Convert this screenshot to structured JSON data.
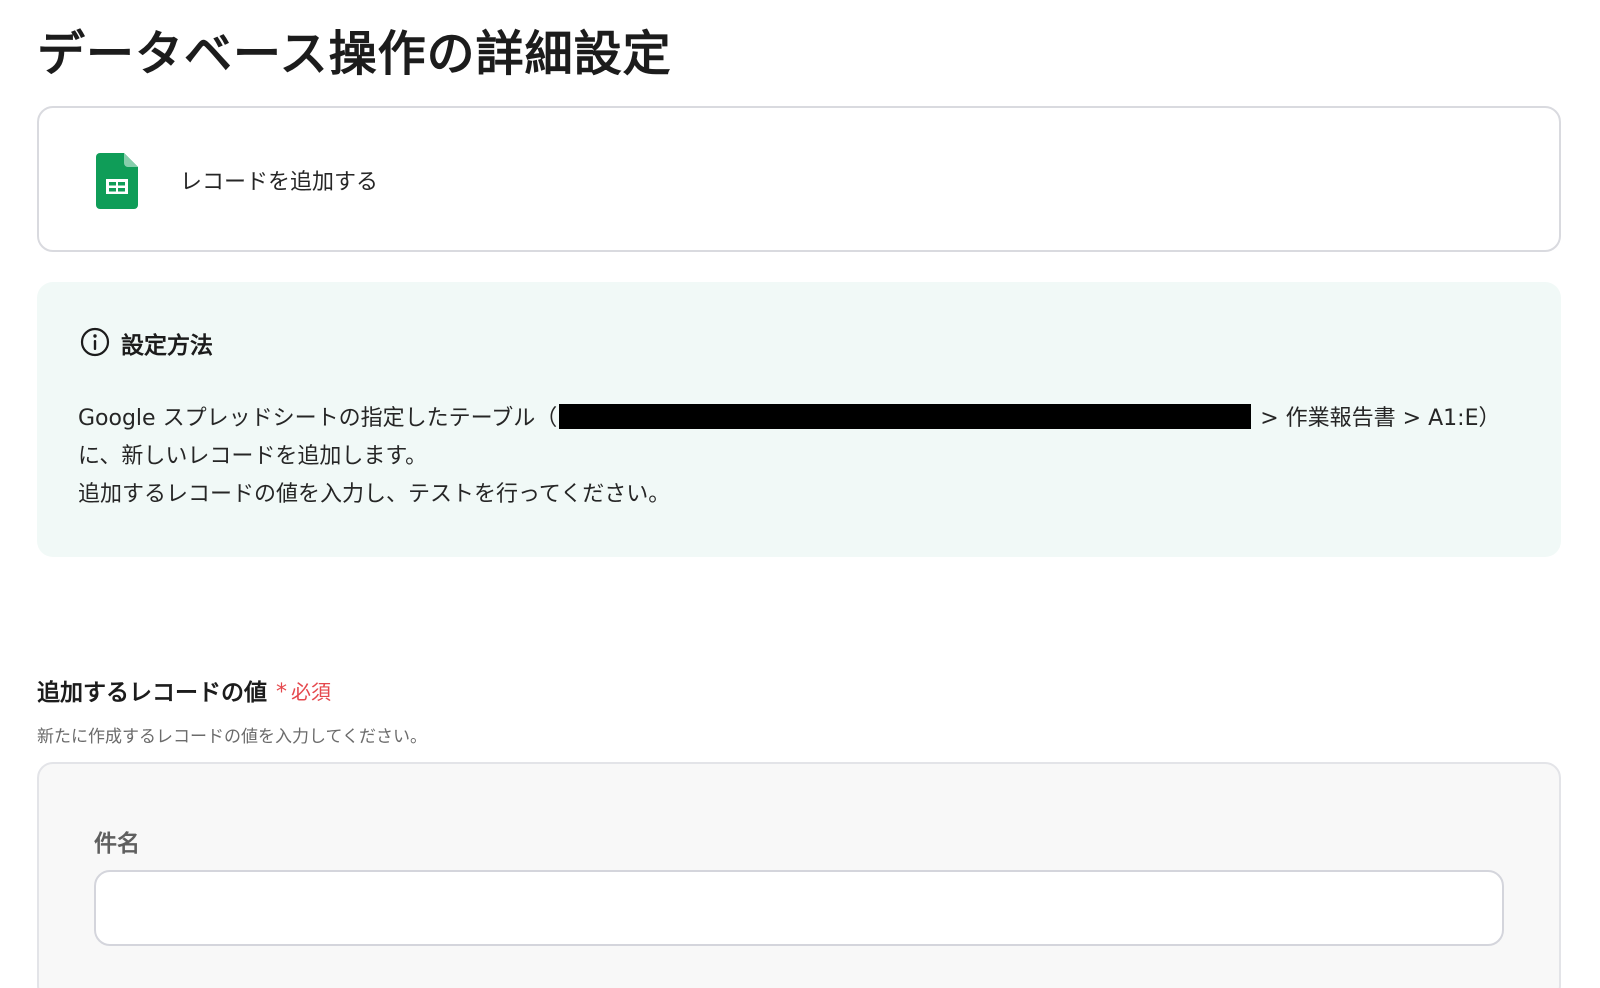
{
  "page": {
    "title": "データベース操作の詳細設定"
  },
  "action": {
    "label": "レコードを追加する",
    "icon": "google-sheets-icon"
  },
  "info": {
    "heading": "設定方法",
    "line1_prefix": "Google スプレッドシートの指定したテーブル（",
    "line1_suffix": " > 作業報告書 > A1:E）",
    "line2": "に、新しいレコードを追加します。",
    "line3": "追加するレコードの値を入力し、テストを行ってください。"
  },
  "record_section": {
    "label": "追加するレコードの値",
    "required": "必須",
    "required_mark": "*",
    "description": "新たに作成するレコードの値を入力してください。",
    "fields": [
      {
        "label": "件名",
        "value": "",
        "placeholder": ""
      }
    ]
  },
  "colors": {
    "sheets_green": "#0f9d58",
    "info_bg": "#f1f9f7",
    "required_red": "#e5484d"
  }
}
